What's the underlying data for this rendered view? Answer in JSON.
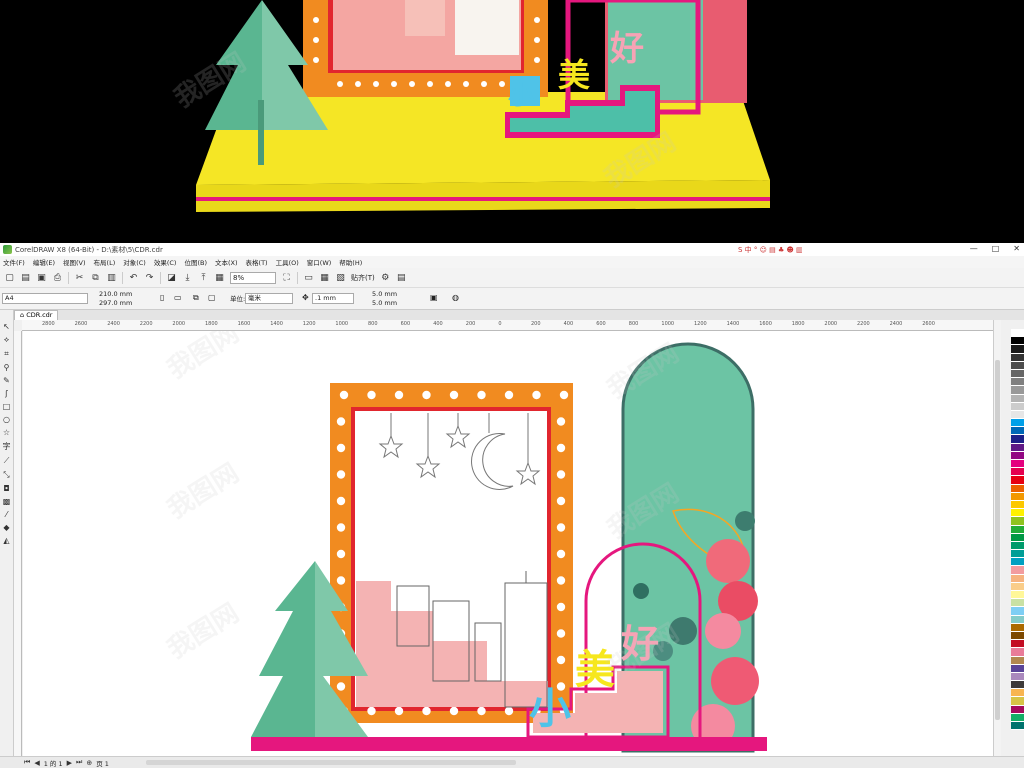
{
  "titlebar": {
    "title": "CorelDRAW X8 (64-Bit) - D:\\素材\\5\\CDR.cdr",
    "sys_icons": "S 中 ° ☺ ▤ ♣ ☻ ▥",
    "window_buttons": [
      "—",
      "□",
      "✕"
    ]
  },
  "menubar": {
    "items": [
      "文件(F)",
      "编辑(E)",
      "视图(V)",
      "布局(L)",
      "对象(C)",
      "效果(C)",
      "位图(B)",
      "文本(X)",
      "表格(T)",
      "工具(O)",
      "窗口(W)",
      "帮助(H)"
    ]
  },
  "toolbar": {
    "zoom": "8%",
    "snap_label": "贴齐(T)"
  },
  "propbar": {
    "page_size": "A4",
    "width": "210.0 mm",
    "height": "297.0 mm",
    "units_label": "单位:",
    "units": "毫米",
    "nudge": ".1 mm",
    "dup_x": "5.0 mm",
    "dup_y": "5.0 mm"
  },
  "doctab": {
    "label": "CDR.cdr"
  },
  "hruler": {
    "ticks": [
      "2800",
      "2600",
      "2400",
      "2200",
      "2000",
      "1800",
      "1600",
      "1400",
      "1200",
      "1000",
      "800",
      "600",
      "400",
      "200",
      "0",
      "200",
      "400",
      "600",
      "800",
      "1000",
      "1200",
      "1400",
      "1600",
      "1800",
      "2000",
      "2200",
      "2400",
      "2600"
    ]
  },
  "statusbar": {
    "page_info": "1  的 1",
    "page_tab": "页 1"
  },
  "design": {
    "title_chars": [
      "小",
      "美",
      "好"
    ]
  },
  "watermark_text": "我图网",
  "colors": {
    "orange_frame": "#f18b20",
    "red_inner": "#e1262e",
    "magenta": "#e5177e",
    "teal_arch": "#6cc4a4",
    "dark_teal": "#3d6e66",
    "pink_blocks": "#f4b3b3",
    "tree_green": "#5ab691",
    "tree_light": "#7fc8a9",
    "yellow_base": "#f5e625",
    "cyan": "#4fc3e8",
    "yellow_text": "#f6e71e",
    "pink_text": "#f7a3b5"
  },
  "palette_colors": [
    "#ffffff",
    "#000000",
    "#1a1a1a",
    "#333333",
    "#4d4d4d",
    "#666666",
    "#808080",
    "#999999",
    "#b3b3b3",
    "#cccccc",
    "#e6e6e6",
    "#00a0e9",
    "#0068b7",
    "#1d2088",
    "#601986",
    "#920783",
    "#e4007f",
    "#e5004f",
    "#e60012",
    "#eb6100",
    "#f39800",
    "#fcc800",
    "#fff100",
    "#8fc31f",
    "#22ac38",
    "#009944",
    "#009b6b",
    "#009e96",
    "#00a0c1",
    "#f29c9f",
    "#f6b37f",
    "#facd89",
    "#fff799",
    "#c9e1a4",
    "#7ecef4",
    "#84ccc9",
    "#ac6a00",
    "#7d4900",
    "#c30d23",
    "#e97c99",
    "#b28850",
    "#5a4498",
    "#aa89bd",
    "#3e3a39",
    "#f8b551",
    "#d7c447",
    "#a40b5d",
    "#13ae67",
    "#00736d"
  ]
}
